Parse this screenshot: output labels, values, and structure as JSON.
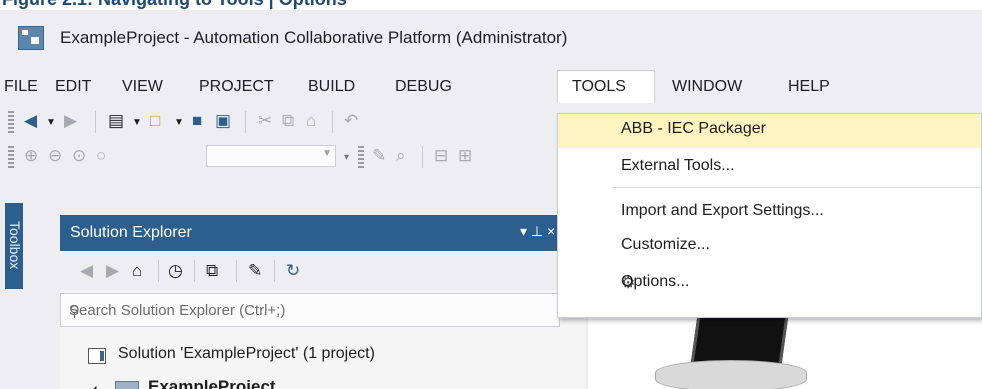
{
  "caption": "Figure 2.1: Navigating to Tools | Options",
  "window": {
    "title": "ExampleProject - Automation Collaborative Platform (Administrator)"
  },
  "menubar": {
    "items": [
      {
        "label": "FILE"
      },
      {
        "label": "EDIT"
      },
      {
        "label": "VIEW"
      },
      {
        "label": "PROJECT"
      },
      {
        "label": "BUILD"
      },
      {
        "label": "DEBUG"
      },
      {
        "label": "TOOLS"
      },
      {
        "label": "WINDOW"
      },
      {
        "label": "HELP"
      }
    ],
    "open_menu": "TOOLS"
  },
  "tools_menu": {
    "items": [
      {
        "label": "ABB - IEC Packager",
        "highlighted": true
      },
      {
        "label": "External Tools..."
      },
      {
        "label": "Import and Export Settings..."
      },
      {
        "label": "Customize..."
      },
      {
        "label": "Options...",
        "icon": "gear-icon"
      }
    ]
  },
  "toolbox": {
    "label": "Toolbox"
  },
  "solution_explorer": {
    "title": "Solution Explorer",
    "pin_glyphs": "▾ ⊥ ×",
    "search_placeholder": "Search Solution Explorer (Ctrl+;)",
    "tree": [
      {
        "label": "Solution 'ExampleProject' (1 project)"
      },
      {
        "label": "ExampleProject"
      }
    ]
  },
  "colors": {
    "accent": "#2d5f8e",
    "menu_highlight": "#fdf4bf",
    "chrome": "#eeeef2"
  }
}
